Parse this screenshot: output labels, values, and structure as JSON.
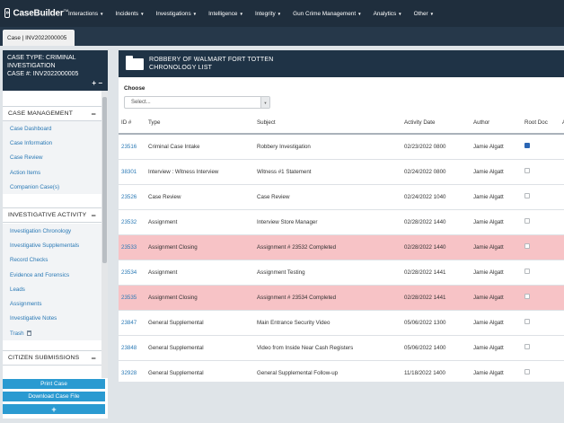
{
  "brand": {
    "name": "CaseBuilder",
    "trademark": "TM",
    "logo_glyph": "»"
  },
  "nav": [
    {
      "label": "Interactions"
    },
    {
      "label": "Incidents"
    },
    {
      "label": "Investigations"
    },
    {
      "label": "Intelligence"
    },
    {
      "label": "Integrity"
    },
    {
      "label": "Gun Crime Management"
    },
    {
      "label": "Analytics"
    },
    {
      "label": "Other"
    }
  ],
  "tab": {
    "label": "Case | INV2022000005"
  },
  "case_info": {
    "line1": "CASE TYPE: CRIMINAL",
    "line2": "INVESTIGATION",
    "line3": "CASE #: INV2022000005",
    "tools": "+ −"
  },
  "sidebar": {
    "case_management": {
      "title": "CASE MANAGEMENT",
      "toggle": "−",
      "items": [
        "Case Dashboard",
        "Case Information",
        "Case Review",
        "Action Items",
        "Companion Case(s)"
      ]
    },
    "investigative_activity": {
      "title": "INVESTIGATIVE ACTIVITY",
      "toggle": "−",
      "items": [
        "Investigation Chronology",
        "Investigative Supplementals",
        "Record Checks",
        "Evidence and Forensics",
        "Leads",
        "Assignments",
        "Investigative Notes",
        "Trash"
      ]
    },
    "citizen_submissions": {
      "title": "CITIZEN SUBMISSIONS",
      "toggle": "−"
    },
    "buttons": {
      "print": "Print Case",
      "download": "Download Case File",
      "add": "+"
    }
  },
  "main": {
    "title_line1": "ROBBERY OF WALMART FORT TOTTEN",
    "title_line2": "CHRONOLOGY LIST",
    "choose_label": "Choose",
    "select_value": "Select...",
    "columns": [
      "ID #",
      "Type",
      "Subject",
      "Activity Date",
      "Author",
      "Root Doc",
      "A"
    ],
    "rows": [
      {
        "id": "23516",
        "type": "Criminal Case Intake",
        "subject": "Robbery Investigation",
        "date": "02/23/2022 0800",
        "author": "Jamie Algatt",
        "root": true,
        "highlight": false
      },
      {
        "id": "38301",
        "type": "Interview : Witness Interview",
        "subject": "Witness #1 Statement",
        "date": "02/24/2022 0800",
        "author": "Jamie Algatt",
        "root": false,
        "highlight": false
      },
      {
        "id": "23526",
        "type": "Case Review",
        "subject": "Case Review",
        "date": "02/24/2022 1040",
        "author": "Jamie Algatt",
        "root": false,
        "highlight": false
      },
      {
        "id": "23532",
        "type": "Assignment",
        "subject": "Interview Store Manager",
        "date": "02/28/2022 1440",
        "author": "Jamie Algatt",
        "root": false,
        "highlight": false
      },
      {
        "id": "23533",
        "type": "Assignment Closing",
        "subject": "Assignment # 23532 Completed",
        "date": "02/28/2022 1440",
        "author": "Jamie Algatt",
        "root": false,
        "highlight": true
      },
      {
        "id": "23534",
        "type": "Assignment",
        "subject": "Assignment Testing",
        "date": "02/28/2022 1441",
        "author": "Jamie Algatt",
        "root": false,
        "highlight": false
      },
      {
        "id": "23535",
        "type": "Assignment Closing",
        "subject": "Assignment # 23534 Completed",
        "date": "02/28/2022 1441",
        "author": "Jamie Algatt",
        "root": false,
        "highlight": true
      },
      {
        "id": "23847",
        "type": "General Supplemental",
        "subject": "Main Entrance Security Video",
        "date": "05/06/2022 1300",
        "author": "Jamie Algatt",
        "root": false,
        "highlight": false
      },
      {
        "id": "23848",
        "type": "General Supplemental",
        "subject": "Video from Inside Near Cash Registers",
        "date": "05/06/2022 1400",
        "author": "Jamie Algatt",
        "root": false,
        "highlight": false
      },
      {
        "id": "32928",
        "type": "General Supplemental",
        "subject": "General Supplemental Follow-up",
        "date": "11/18/2022 1400",
        "author": "Jamie Algatt",
        "root": false,
        "highlight": false
      }
    ]
  },
  "colors": {
    "nav_bg": "#1f2e3d",
    "accent": "#2a9ad1",
    "link": "#2a79b5",
    "highlight_row": "#f7c3c6"
  }
}
